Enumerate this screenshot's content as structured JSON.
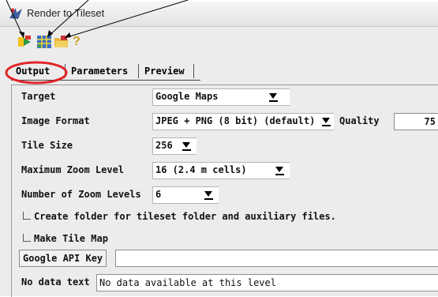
{
  "window": {
    "title": "Render to Tileset"
  },
  "toolbar": {
    "icons": [
      "render-icon",
      "tileset-grid-icon",
      "open-folder-icon",
      "help-icon"
    ],
    "help_glyph": "?"
  },
  "tabs": [
    {
      "label": "Output",
      "active": true
    },
    {
      "label": "Parameters",
      "active": false
    },
    {
      "label": "Preview",
      "active": false
    }
  ],
  "form": {
    "target_label": "Target",
    "target_value": "Google Maps",
    "image_format_label": "Image Format",
    "image_format_value": "JPEG + PNG (8 bit) (default)",
    "quality_label": "Quality",
    "quality_value": "75",
    "tile_size_label": "Tile Size",
    "tile_size_value": "256",
    "max_zoom_label": "Maximum Zoom Level",
    "max_zoom_value": "16 (2.4 m cells)",
    "num_zoom_label": "Number of Zoom Levels",
    "num_zoom_value": "6",
    "create_folder_label": "Create folder for tileset folder and auxiliary files.",
    "create_folder_checked": false,
    "make_tile_map_label": "Make Tile Map",
    "make_tile_map_checked": false,
    "google_api_key_label": "Google API Key",
    "google_api_key_value": "",
    "no_data_label": "No data text",
    "no_data_value": "No data available at this level"
  },
  "colors": {
    "callout_ring": "#e0242a",
    "panel_bg": "#ececec",
    "arrow": "#000000"
  }
}
